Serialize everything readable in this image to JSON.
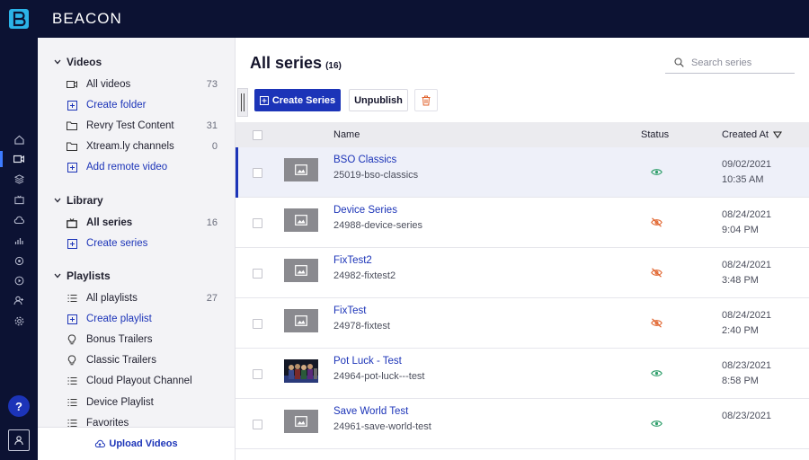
{
  "brand": {
    "name": "BEACON"
  },
  "rail": {
    "icons": [
      "home-icon",
      "video-icon",
      "layers-icon",
      "tv-icon",
      "cloud-icon",
      "analytics-icon",
      "circle-icon",
      "play-icon",
      "user-add-icon",
      "settings-icon"
    ],
    "help_label": "?"
  },
  "sidebar": {
    "videos": {
      "heading": "Videos",
      "items": [
        {
          "label": "All videos",
          "count": "73",
          "icon": "video-icon"
        },
        {
          "label": "Create folder",
          "count": "",
          "icon": "plus-square-icon"
        },
        {
          "label": "Revry Test Content",
          "count": "31",
          "icon": "folder-icon"
        },
        {
          "label": "Xtream.ly channels",
          "count": "0",
          "icon": "folder-icon"
        },
        {
          "label": "Add remote video",
          "count": "",
          "icon": "plus-square-icon"
        }
      ]
    },
    "library": {
      "heading": "Library",
      "items": [
        {
          "label": "All series",
          "count": "16",
          "icon": "tv-icon"
        },
        {
          "label": "Create series",
          "count": "",
          "icon": "plus-square-icon"
        }
      ]
    },
    "playlists": {
      "heading": "Playlists",
      "items": [
        {
          "label": "All playlists",
          "count": "27",
          "icon": "list-icon"
        },
        {
          "label": "Create playlist",
          "count": "",
          "icon": "plus-square-icon"
        },
        {
          "label": "Bonus Trailers",
          "count": "",
          "icon": "bulb-icon"
        },
        {
          "label": "Classic Trailers",
          "count": "",
          "icon": "bulb-icon"
        },
        {
          "label": "Cloud Playout Channel",
          "count": "",
          "icon": "list-icon"
        },
        {
          "label": "Device Playlist",
          "count": "",
          "icon": "list-icon"
        },
        {
          "label": "Favorites",
          "count": "",
          "icon": "list-icon"
        }
      ]
    },
    "upload_label": "Upload Videos"
  },
  "main": {
    "title": "All series",
    "count": "(16)",
    "search_placeholder": "Search series",
    "toolbar": {
      "create_label": "Create Series",
      "unpublish_label": "Unpublish"
    },
    "table": {
      "headers": {
        "name": "Name",
        "status": "Status",
        "created": "Created At"
      },
      "rows": [
        {
          "name": "BSO Classics",
          "slug": "25019-bso-classics",
          "status": "published",
          "date": "09/02/2021",
          "time": "10:35 AM",
          "thumb": "placeholder"
        },
        {
          "name": "Device Series",
          "slug": "24988-device-series",
          "status": "unpublished",
          "date": "08/24/2021",
          "time": "9:04 PM",
          "thumb": "placeholder"
        },
        {
          "name": "FixTest2",
          "slug": "24982-fixtest2",
          "status": "unpublished",
          "date": "08/24/2021",
          "time": "3:48 PM",
          "thumb": "placeholder"
        },
        {
          "name": "FixTest",
          "slug": "24978-fixtest",
          "status": "unpublished",
          "date": "08/24/2021",
          "time": "2:40 PM",
          "thumb": "placeholder"
        },
        {
          "name": "Pot Luck - Test",
          "slug": "24964-pot-luck---test",
          "status": "published",
          "date": "08/23/2021",
          "time": "8:58 PM",
          "thumb": "photo"
        },
        {
          "name": "Save World Test",
          "slug": "24961-save-world-test",
          "status": "published",
          "date": "08/23/2021",
          "time": "",
          "thumb": "placeholder"
        }
      ]
    }
  },
  "colors": {
    "accent": "#1c34b8",
    "nav_dark": "#0c1233",
    "published": "#2e9e6a",
    "unpublished": "#e0622b",
    "delete": "#e0622b"
  }
}
